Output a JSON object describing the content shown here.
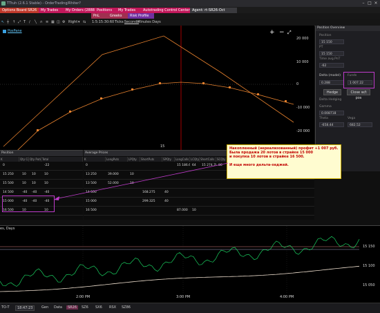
{
  "window": {
    "title": "TTtuh (2.6.1 Stable) - OrderTrading/Rhiter?"
  },
  "tabs": [
    {
      "label": "Options Board SR26",
      "color": "#c0392b"
    },
    {
      "label": "My Trades",
      "color": "#c2185b"
    },
    {
      "label": "My Orders (2888)",
      "color": "#c2185b"
    },
    {
      "label": "Positions",
      "color": "#c2185b"
    },
    {
      "label": "My Trades",
      "color": "#c2185b"
    },
    {
      "label": "Autotrading Control Center",
      "color": "#c2185b"
    },
    {
      "label": "Agent: rt-SR26-Oct",
      "color": "#3a3a3e"
    }
  ],
  "tabs2": [
    {
      "label": "PnL",
      "color": "#a03050"
    },
    {
      "label": "Greeks",
      "color": "#a03050"
    },
    {
      "label": "Risk Profile",
      "color": "#7030a0"
    }
  ],
  "toolbar": {
    "mode": "Right",
    "time": "1:5:15:30:60",
    "ticks_label": "Ticks:",
    "ticks_link": "Seconds",
    "rest": "Minutes  Days"
  },
  "chart": {
    "legend": "PosPane",
    "x_tick": "15",
    "y_ticks": [
      "20 000",
      "10 000",
      "0",
      "-10 000",
      "-20 000"
    ]
  },
  "position_overview": {
    "title": "Position Overview",
    "fields": [
      {
        "label": "Position",
        "value": "15 150"
      },
      {
        "label": "PT",
        "value": "15 150"
      },
      {
        "label": "Time avg.PnT",
        "value": "-62"
      }
    ],
    "delta_label": "Delta (model)",
    "delta_value": "0.288",
    "hedge_label": "Funds",
    "hedge_value": "1 007.22",
    "hedge_button": "Hedge",
    "close_button": "Close w/t pos",
    "extra": [
      {
        "label": "Delta Hedging",
        "value": ""
      },
      {
        "label": "Gamma",
        "value": "0.008718"
      },
      {
        "label": "Theta",
        "value": "-658.44"
      },
      {
        "label": "Vega",
        "value": "682.52"
      }
    ]
  },
  "position_table": {
    "title": "Position",
    "headers": [
      "K",
      "Qty Calls",
      "Qty Puts",
      "Total"
    ],
    "rows": [
      [
        "0",
        "",
        "",
        "-22"
      ],
      [
        "15 250",
        "10",
        "10",
        "10"
      ],
      [
        "15 500",
        "10",
        "10",
        "10"
      ],
      [
        "14 500",
        "-40",
        "-40",
        "-40"
      ],
      [
        "15 000",
        "-40",
        "-40",
        "-40"
      ],
      [
        "16 500",
        "10",
        "",
        "10"
      ]
    ]
  },
  "avg_table": {
    "title": "Average Prices",
    "headers": [
      "K",
      "LongPuts",
      "LPQty",
      "ShortPuts",
      "SPQty",
      "LongCalls",
      "LCQty",
      "ShortCalls",
      "SCQty"
    ],
    "rows": [
      [
        "0",
        "",
        "",
        "",
        "",
        "15 186.661",
        "64",
        "15 274.789",
        "86"
      ],
      [
        "13 250",
        "39.000",
        "10",
        "",
        "",
        "",
        "",
        "",
        ""
      ],
      [
        "13 500",
        "52.000",
        "10",
        "",
        "",
        "",
        "",
        "",
        ""
      ],
      [
        "14 500",
        "",
        "",
        "168.275",
        "40",
        "",
        "",
        "",
        ""
      ],
      [
        "15 000",
        "",
        "",
        "299.325",
        "40",
        "",
        "",
        "",
        ""
      ],
      [
        "16 500",
        "",
        "",
        "",
        "",
        "87.000",
        "10",
        "",
        ""
      ]
    ]
  },
  "note": {
    "lines": [
      "Накопленный (нереализованный) профит +1 007 руб.",
      "Была продажа 20 лотов в страйке 15 000",
      "  и покупка 10 лотов в страйке 16 500.",
      "",
      "И еще много дельта-хеджей."
    ]
  },
  "bottom_chart": {
    "header": "es, Days",
    "y_ticks": [
      "15 150",
      "15 100",
      "15 050"
    ],
    "x_ticks": [
      "2:00 PM",
      "3:00 PM",
      "4:00 PM"
    ]
  },
  "statusbar": {
    "items": [
      "TO-T",
      "18:47:23",
      "Gen",
      "Data",
      "SR26",
      "SZ6",
      "SX6",
      "RSX",
      "SZ86"
    ]
  }
}
